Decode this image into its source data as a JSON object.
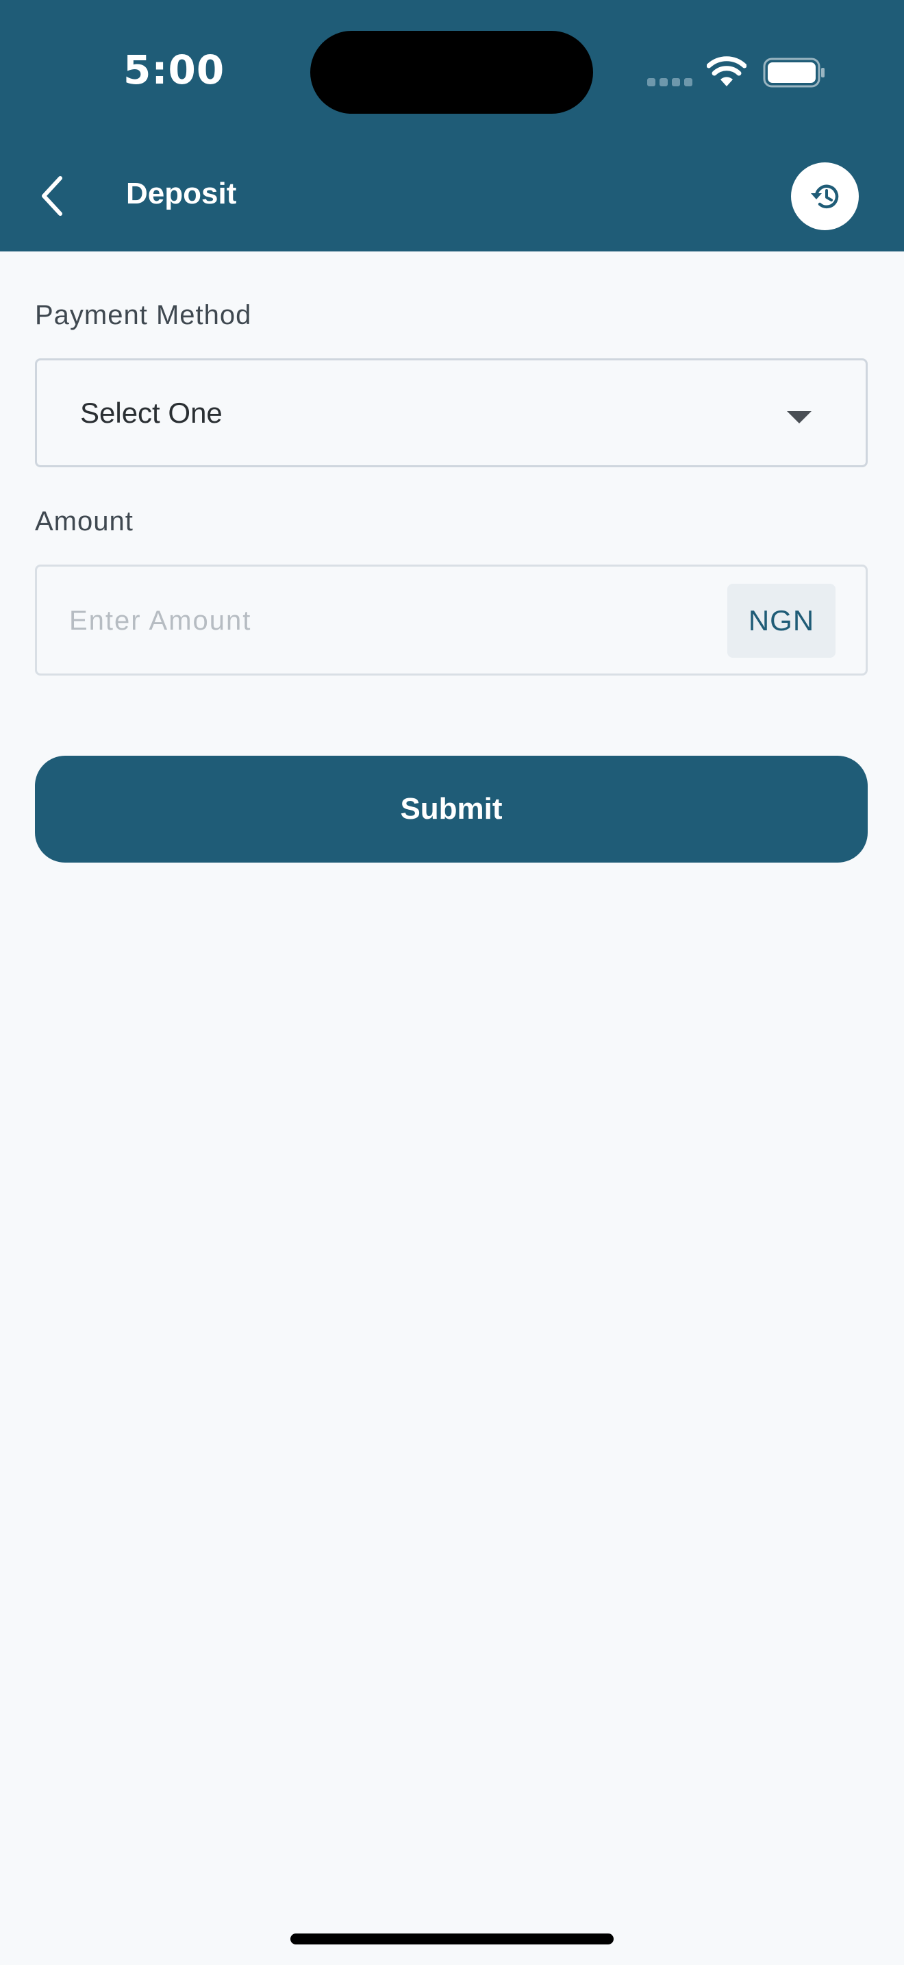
{
  "status_bar": {
    "time": "5:00"
  },
  "header": {
    "title": "Deposit",
    "back_icon": "chevron-left-icon",
    "history_icon": "history-icon",
    "background_color": "#1f5c77"
  },
  "form": {
    "payment_method": {
      "label": "Payment Method",
      "selected_value": "Select One"
    },
    "amount": {
      "label": "Amount",
      "placeholder": "Enter Amount",
      "value": "",
      "currency": "NGN"
    },
    "submit_label": "Submit"
  },
  "colors": {
    "primary": "#1f5c77",
    "background": "#f7f9fb"
  }
}
